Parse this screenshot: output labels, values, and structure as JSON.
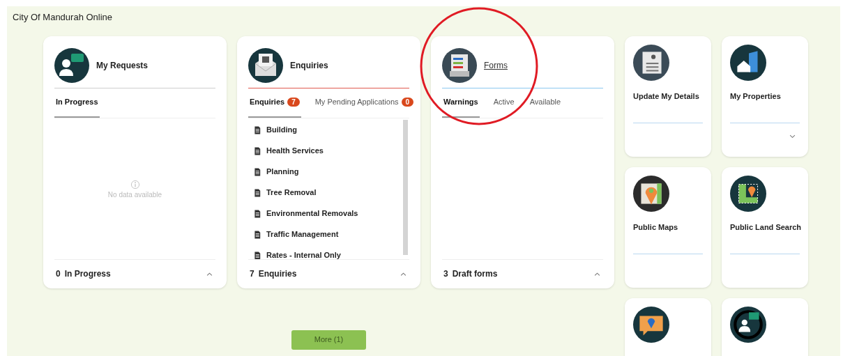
{
  "header": {
    "title": "City Of Mandurah Online"
  },
  "panels": [
    {
      "kind": "requests",
      "title": "My Requests",
      "title_link": false,
      "color": "#cfcfcf",
      "tabs": [
        {
          "label": "In Progress",
          "selected": true
        }
      ],
      "empty_message": "No data available",
      "footer": {
        "count": "0",
        "label": "In Progress"
      }
    },
    {
      "kind": "enquiries",
      "title": "Enquiries",
      "title_link": false,
      "color": "#e05a4f",
      "tabs": [
        {
          "label": "Enquiries",
          "badge": "7",
          "selected": true
        },
        {
          "label": "My Pending Applications",
          "badge": "0",
          "selected": false
        }
      ],
      "items": [
        "Building",
        "Health Services",
        "Planning",
        "Tree Removal",
        "Environmental Removals",
        "Traffic Management",
        "Rates - Internal Only"
      ],
      "footer": {
        "count": "7",
        "label": "Enquiries"
      }
    },
    {
      "kind": "forms",
      "title": "Forms",
      "title_link": true,
      "color": "#8cc8f0",
      "tabs": [
        {
          "label": "Warnings",
          "selected": true
        },
        {
          "label": "Active",
          "selected": false
        },
        {
          "label": "Available",
          "selected": false
        }
      ],
      "footer": {
        "count": "3",
        "label": "Draft forms"
      }
    }
  ],
  "tiles": [
    {
      "kind": "contact",
      "title": "Update My Details",
      "expandable": false
    },
    {
      "kind": "buildings",
      "title": "My Properties",
      "expandable": true
    },
    {
      "kind": "map",
      "title": "Public Maps",
      "expandable": false
    },
    {
      "kind": "land",
      "title": "Public Land Search",
      "expandable": false
    },
    {
      "kind": "report",
      "expandable": false
    },
    {
      "kind": "person",
      "expandable": false
    }
  ],
  "more_button": {
    "label": "More (1)"
  }
}
